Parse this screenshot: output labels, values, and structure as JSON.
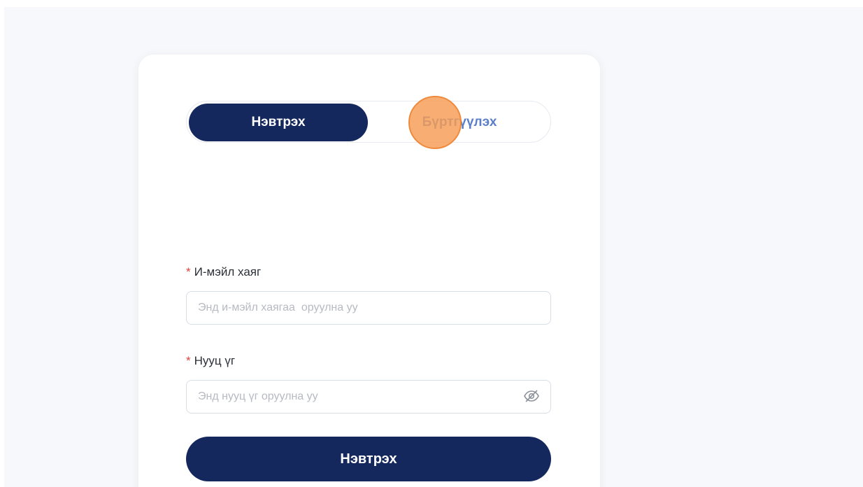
{
  "tabs": {
    "login_label": "Нэвтрэх",
    "register_label": "Бүртгүүлэх"
  },
  "email": {
    "required_mark": "*",
    "label": "И-мэйл хаяг",
    "placeholder": "Энд и-мэйл хаягаа  оруулна уу",
    "value": ""
  },
  "password": {
    "required_mark": "*",
    "label": "Нууц үг",
    "placeholder": "Энд нууц үг оруулна уу",
    "value": "",
    "toggle_icon": "eye-off-icon"
  },
  "submit": {
    "label": "Нэвтрэх"
  },
  "colors": {
    "primary": "#14285e",
    "inactive_tab_text": "#5b7fc6",
    "required": "#e0423a",
    "click_marker": "#f79c54"
  }
}
